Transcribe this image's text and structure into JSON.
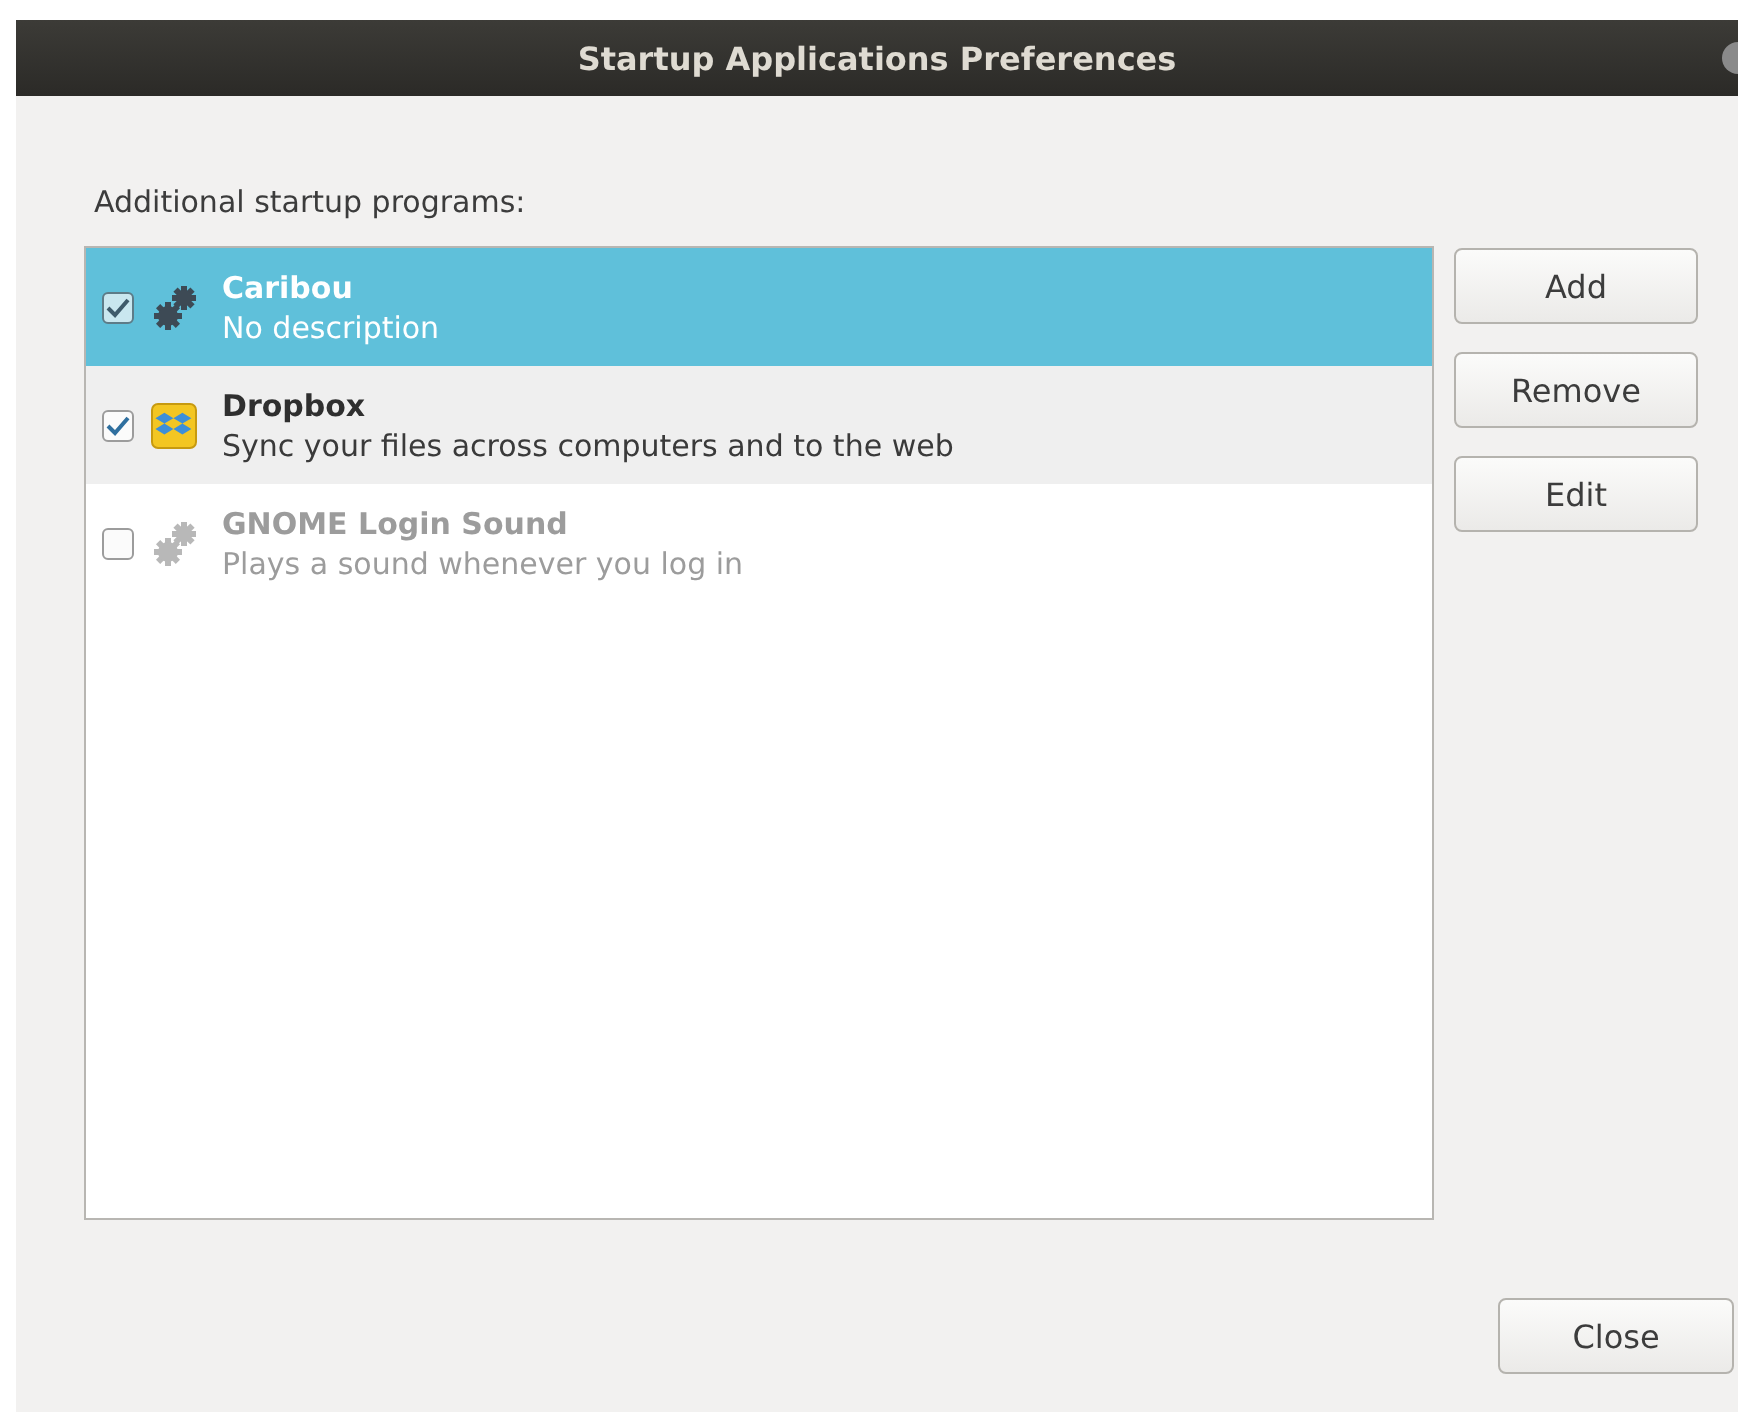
{
  "window": {
    "title": "Startup Applications Preferences"
  },
  "list_label": "Additional startup programs:",
  "programs": [
    {
      "name": "Caribou",
      "description": "No description",
      "kind": "generic",
      "checked": true,
      "selected": true,
      "hovered": false,
      "disabled": false
    },
    {
      "name": "Dropbox",
      "description": "Sync your files across computers and to the web",
      "kind": "branded",
      "checked": true,
      "selected": false,
      "hovered": true,
      "disabled": false
    },
    {
      "name": "GNOME Login Sound",
      "description": "Plays a sound whenever you log in",
      "kind": "generic",
      "checked": false,
      "selected": false,
      "hovered": false,
      "disabled": true
    }
  ],
  "buttons": [
    "Add",
    "Remove",
    "Edit"
  ],
  "close_button": "Close"
}
